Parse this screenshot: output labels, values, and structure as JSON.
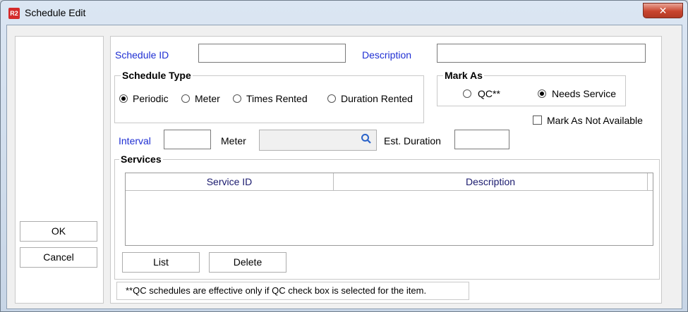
{
  "window": {
    "title": "Schedule Edit",
    "icon_text": "R2",
    "close_glyph": "✕"
  },
  "left_panel": {
    "ok_label": "OK",
    "cancel_label": "Cancel"
  },
  "form": {
    "schedule_id_label": "Schedule ID",
    "schedule_id_value": "",
    "description_label": "Description",
    "description_value": "",
    "schedule_type": {
      "title": "Schedule Type",
      "options": [
        "Periodic",
        "Meter",
        "Times Rented",
        "Duration Rented"
      ],
      "selected": "Periodic"
    },
    "mark_as": {
      "title": "Mark As",
      "options": [
        "QC**",
        "Needs Service"
      ],
      "selected": "Needs Service"
    },
    "mark_not_available_label": "Mark As Not Available",
    "mark_not_available_checked": false,
    "interval_label": "Interval",
    "interval_value": "",
    "meter_label": "Meter",
    "meter_value": "",
    "est_duration_label": "Est.  Duration",
    "est_duration_value": ""
  },
  "services": {
    "title": "Services",
    "columns": [
      "Service ID",
      "Description"
    ],
    "rows": [],
    "list_label": "List",
    "delete_label": "Delete"
  },
  "footnote": "**QC schedules are effective only if QC check box is selected for the item.",
  "colors": {
    "link_blue": "#1f2fd3",
    "close_red": "#c8452f",
    "header_navy": "#1a1a6e"
  }
}
